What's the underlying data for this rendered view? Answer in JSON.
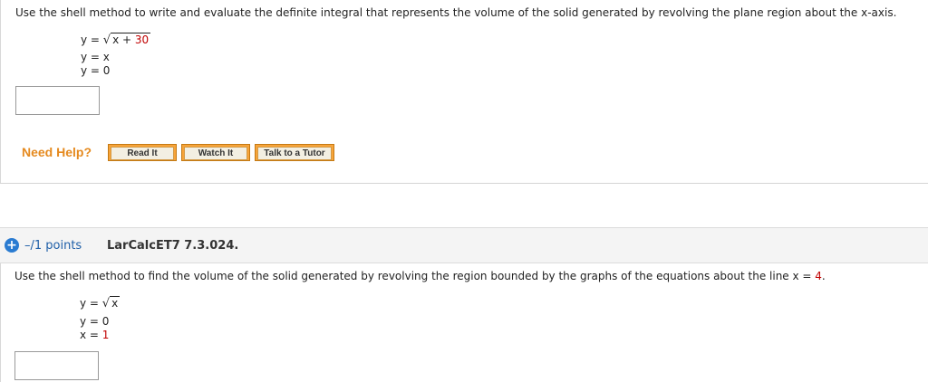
{
  "question1": {
    "prompt": "Use the shell method to write and evaluate the definite integral that represents the volume of the solid generated by revolving the plane region about the x-axis.",
    "eq1_lhs": "y = ",
    "eq1_radicand": "x + ",
    "eq1_const": "30",
    "eq2": "y = x",
    "eq3": "y = 0",
    "answer_value": "",
    "need_help_label": "Need Help?",
    "buttons": {
      "read_it": "Read It",
      "watch_it": "Watch It",
      "talk_to_tutor": "Talk to a Tutor"
    }
  },
  "question2": {
    "points": "–/1 points",
    "id": "LarCalcET7 7.3.024.",
    "prompt_main": "Use the shell method to find the volume of the solid generated by revolving the region bounded by the graphs of the equations about the line x = ",
    "prompt_value": "4",
    "prompt_end": ".",
    "eq1_lhs": "y = ",
    "eq1_radicand": "x",
    "eq2": "y = 0",
    "eq3_lhs": "x = ",
    "eq3_value": "1",
    "answer_value": ""
  },
  "colors": {
    "accent_orange": "#e58a1f",
    "button_orange": "#f7a43a",
    "link_blue": "#1f5fa8",
    "highlight_red": "#c00000"
  },
  "icons": {
    "expand": "plus-circle-icon"
  }
}
